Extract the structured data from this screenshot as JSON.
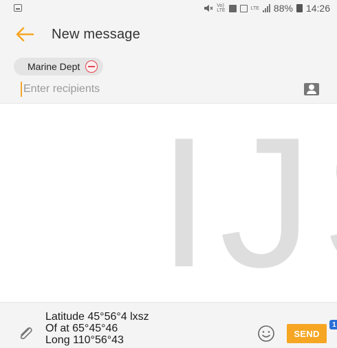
{
  "status_bar": {
    "battery": "88%",
    "time": "14:26",
    "volte_label": "Vo)\nLTE",
    "lte_label": "LTE"
  },
  "header": {
    "title": "New message"
  },
  "recipients": {
    "chips": [
      {
        "label": "Marine Dept"
      }
    ],
    "placeholder": "Enter recipients"
  },
  "watermark": {
    "text": "IJS"
  },
  "composer": {
    "message": "Latitude 45°56°4 lxsz\nOf at 65°45°46\nLong 110°56°43",
    "send_label": "SEND",
    "send_badge": "1"
  },
  "colors": {
    "accent": "#f6a623",
    "remove_red": "#e0454f",
    "badge_blue": "#2a6fd6"
  },
  "icons": {
    "back": "arrow-left-icon",
    "contact": "contact-card-icon",
    "attach": "paperclip-icon",
    "emoji": "smiley-icon"
  }
}
